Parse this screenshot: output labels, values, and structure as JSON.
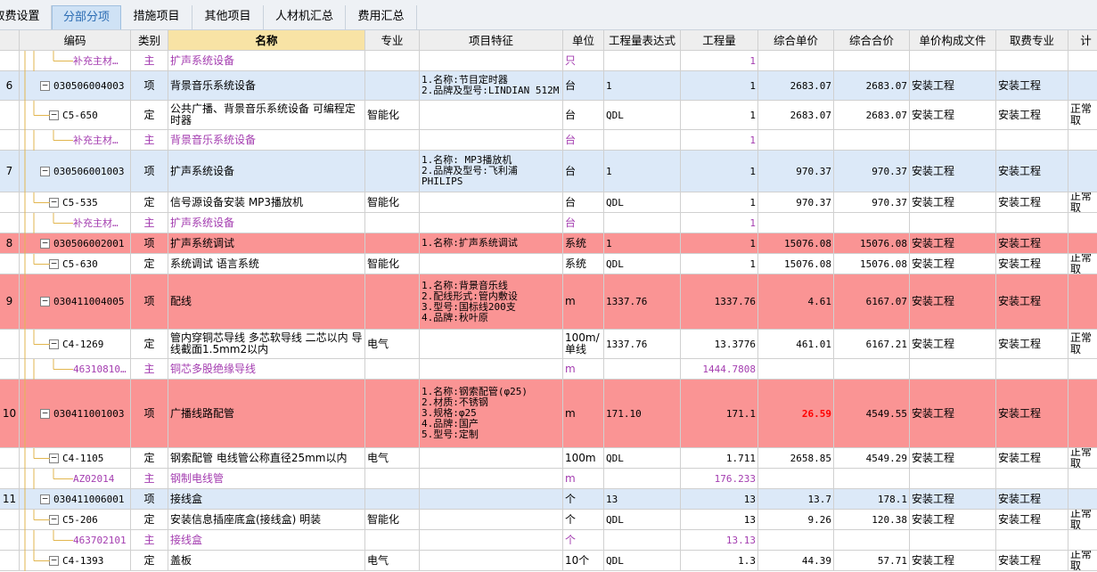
{
  "tabs": [
    {
      "label": "取费设置",
      "active": false
    },
    {
      "label": "分部分项",
      "active": true
    },
    {
      "label": "措施项目",
      "active": false
    },
    {
      "label": "其他项目",
      "active": false
    },
    {
      "label": "人材机汇总",
      "active": false
    },
    {
      "label": "费用汇总",
      "active": false
    }
  ],
  "columns": [
    "",
    "编码",
    "类别",
    "名称",
    "专业",
    "项目特征",
    "单位",
    "工程量表达式",
    "工程量",
    "综合单价",
    "综合合价",
    "单价构成文件",
    "取费专业",
    "计"
  ],
  "rows": [
    {
      "seq": "",
      "level": 2,
      "code": "补充主材…",
      "type": "主",
      "name": "扩声系统设备",
      "spec": "",
      "feature": "",
      "unit": "只",
      "expr": "",
      "qty": "1",
      "uprice": "",
      "total": "",
      "file": "",
      "fee": "",
      "calc": "",
      "style": "white",
      "purple": true
    },
    {
      "seq": "6",
      "level": 0,
      "code": "030506004003",
      "type": "项",
      "name": "背景音乐系统设备",
      "spec": "",
      "feature": "1.名称:节目定时器\n2.品牌及型号:LINDIAN 512M",
      "unit": "台",
      "expr": "1",
      "qty": "1",
      "uprice": "2683.07",
      "total": "2683.07",
      "file": "安装工程",
      "fee": "安装工程",
      "calc": "",
      "style": "blue",
      "purple": false
    },
    {
      "seq": "",
      "level": 1,
      "code": "C5-650",
      "type": "定",
      "name": "公共广播、背景音乐系统设备 可编程定时器",
      "spec": "智能化",
      "feature": "",
      "unit": "台",
      "expr": "QDL",
      "qty": "1",
      "uprice": "2683.07",
      "total": "2683.07",
      "file": "安装工程",
      "fee": "安装工程",
      "calc": "正常取",
      "style": "white",
      "purple": false
    },
    {
      "seq": "",
      "level": 2,
      "code": "补充主材…",
      "type": "主",
      "name": "背景音乐系统设备",
      "spec": "",
      "feature": "",
      "unit": "台",
      "expr": "",
      "qty": "1",
      "uprice": "",
      "total": "",
      "file": "",
      "fee": "",
      "calc": "",
      "style": "white",
      "purple": true
    },
    {
      "seq": "7",
      "level": 0,
      "code": "030506001003",
      "type": "项",
      "name": "扩声系统设备",
      "spec": "",
      "feature": "1.名称: MP3播放机\n2.品牌及型号:飞利浦\nPHILIPS",
      "unit": "台",
      "expr": "1",
      "qty": "1",
      "uprice": "970.37",
      "total": "970.37",
      "file": "安装工程",
      "fee": "安装工程",
      "calc": "",
      "style": "blue",
      "purple": false
    },
    {
      "seq": "",
      "level": 1,
      "code": "C5-535",
      "type": "定",
      "name": "信号源设备安装 MP3播放机",
      "spec": "智能化",
      "feature": "",
      "unit": "台",
      "expr": "QDL",
      "qty": "1",
      "uprice": "970.37",
      "total": "970.37",
      "file": "安装工程",
      "fee": "安装工程",
      "calc": "正常取",
      "style": "white",
      "purple": false
    },
    {
      "seq": "",
      "level": 2,
      "code": "补充主材…",
      "type": "主",
      "name": "扩声系统设备",
      "spec": "",
      "feature": "",
      "unit": "台",
      "expr": "",
      "qty": "1",
      "uprice": "",
      "total": "",
      "file": "",
      "fee": "",
      "calc": "",
      "style": "white",
      "purple": true
    },
    {
      "seq": "8",
      "level": 0,
      "code": "030506002001",
      "type": "项",
      "name": "扩声系统调试",
      "spec": "",
      "feature": "1.名称:扩声系统调试",
      "unit": "系统",
      "expr": "1",
      "qty": "1",
      "uprice": "15076.08",
      "total": "15076.08",
      "file": "安装工程",
      "fee": "安装工程",
      "calc": "",
      "style": "red",
      "purple": false
    },
    {
      "seq": "",
      "level": 1,
      "code": "C5-630",
      "type": "定",
      "name": "系统调试 语言系统",
      "spec": "智能化",
      "feature": "",
      "unit": "系统",
      "expr": "QDL",
      "qty": "1",
      "uprice": "15076.08",
      "total": "15076.08",
      "file": "安装工程",
      "fee": "安装工程",
      "calc": "正常取",
      "style": "white",
      "purple": false
    },
    {
      "seq": "9",
      "level": 0,
      "code": "030411004005",
      "type": "项",
      "name": "配线",
      "spec": "",
      "feature": "1.名称:背景音乐线\n2.配线形式:管内敷设\n3.型号:国标线200支\n4.品牌:秋叶原",
      "unit": "m",
      "expr": "1337.76",
      "qty": "1337.76",
      "uprice": "4.61",
      "total": "6167.07",
      "file": "安装工程",
      "fee": "安装工程",
      "calc": "",
      "style": "red",
      "purple": false
    },
    {
      "seq": "",
      "level": 1,
      "code": "C4-1269",
      "type": "定",
      "name": "管内穿铜芯导线 多芯软导线 二芯以内 导线截面1.5mm2以内",
      "spec": "电气",
      "feature": "",
      "unit": "100m/\n单线",
      "expr": "1337.76",
      "qty": "13.3776",
      "uprice": "461.01",
      "total": "6167.21",
      "file": "安装工程",
      "fee": "安装工程",
      "calc": "正常取",
      "style": "white",
      "purple": false
    },
    {
      "seq": "",
      "level": 2,
      "code": "46310810…",
      "type": "主",
      "name": "铜芯多股绝缘导线",
      "spec": "",
      "feature": "",
      "unit": "m",
      "expr": "",
      "qty": "1444.7808",
      "uprice": "",
      "total": "",
      "file": "",
      "fee": "",
      "calc": "",
      "style": "white",
      "purple": true
    },
    {
      "seq": "10",
      "level": 0,
      "code": "030411001003",
      "type": "项",
      "name": "广播线路配管",
      "spec": "",
      "feature": "1.名称:钢索配管(φ25)\n2.材质:不锈钢\n3.规格:φ25\n4.品牌:国产\n5.型号:定制",
      "unit": "m",
      "expr": "171.10",
      "qty": "171.1",
      "uprice": "26.59",
      "total": "4549.55",
      "file": "安装工程",
      "fee": "安装工程",
      "calc": "",
      "style": "red",
      "purple": false,
      "upriceRed": true
    },
    {
      "seq": "",
      "level": 1,
      "code": "C4-1105",
      "type": "定",
      "name": "钢索配管 电线管公称直径25mm以内",
      "spec": "电气",
      "feature": "",
      "unit": "100m",
      "expr": "QDL",
      "qty": "1.711",
      "uprice": "2658.85",
      "total": "4549.29",
      "file": "安装工程",
      "fee": "安装工程",
      "calc": "正常取",
      "style": "white",
      "purple": false
    },
    {
      "seq": "",
      "level": 2,
      "code": "AZ02014",
      "type": "主",
      "name": "钢制电线管",
      "spec": "",
      "feature": "",
      "unit": "m",
      "expr": "",
      "qty": "176.233",
      "uprice": "",
      "total": "",
      "file": "",
      "fee": "",
      "calc": "",
      "style": "white",
      "purple": true
    },
    {
      "seq": "11",
      "level": 0,
      "code": "030411006001",
      "type": "项",
      "name": "接线盒",
      "spec": "",
      "feature": "",
      "unit": "个",
      "expr": "13",
      "qty": "13",
      "uprice": "13.7",
      "total": "178.1",
      "file": "安装工程",
      "fee": "安装工程",
      "calc": "",
      "style": "blue",
      "purple": false
    },
    {
      "seq": "",
      "level": 1,
      "code": "C5-206",
      "type": "定",
      "name": "安装信息插座底盒(接线盒) 明装",
      "spec": "智能化",
      "feature": "",
      "unit": "个",
      "expr": "QDL",
      "qty": "13",
      "uprice": "9.26",
      "total": "120.38",
      "file": "安装工程",
      "fee": "安装工程",
      "calc": "正常取",
      "style": "white",
      "purple": false
    },
    {
      "seq": "",
      "level": 2,
      "code": "463702101",
      "type": "主",
      "name": "接线盒",
      "spec": "",
      "feature": "",
      "unit": "个",
      "expr": "",
      "qty": "13.13",
      "uprice": "",
      "total": "",
      "file": "",
      "fee": "",
      "calc": "",
      "style": "white",
      "purple": true
    },
    {
      "seq": "",
      "level": 1,
      "code": "C4-1393",
      "type": "定",
      "name": "盖板",
      "spec": "电气",
      "feature": "",
      "unit": "10个",
      "expr": "QDL",
      "qty": "1.3",
      "uprice": "44.39",
      "total": "57.71",
      "file": "安装工程",
      "fee": "安装工程",
      "calc": "正常取",
      "style": "white",
      "purple": false
    }
  ]
}
